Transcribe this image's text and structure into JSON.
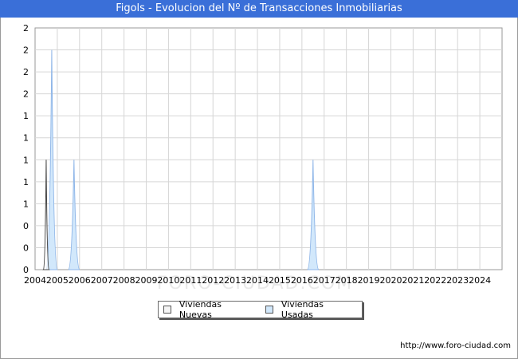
{
  "page": {
    "title": "Figols - Evolucion del Nº de Transacciones Inmobiliarias",
    "watermark": "FORO-CIUDAD.COM",
    "footer_url": "http://www.foro-ciudad.com"
  },
  "legend": {
    "items": [
      {
        "label": "Viviendas Nuevas",
        "color": "#f4f4f4"
      },
      {
        "label": "Viviendas Usadas",
        "color": "#d2e8fb"
      }
    ]
  },
  "colors": {
    "title_bar": "#3a6fd8",
    "grid": "#d6d6d6",
    "nuevas_stroke": "#444444",
    "usadas_fill": "#d2e8fb",
    "usadas_stroke": "#8fb6e8"
  },
  "chart_data": {
    "type": "area",
    "title": "Figols - Evolucion del Nº de Transacciones Inmobiliarias",
    "xlim": [
      2004,
      2025
    ],
    "ylim": [
      0,
      2.2
    ],
    "x_ticks": [
      "2004",
      "2005",
      "2006",
      "2007",
      "2008",
      "2009",
      "2010",
      "2011",
      "2012",
      "2013",
      "2014",
      "2015",
      "2016",
      "2017",
      "2018",
      "2019",
      "2020",
      "2021",
      "2022",
      "2023",
      "2024"
    ],
    "y_ticks": [
      "0",
      "0",
      "0",
      "1",
      "1",
      "1",
      "1",
      "1",
      "2",
      "2",
      "2",
      "2"
    ],
    "grid": true,
    "legend_position": "bottom-center",
    "series": [
      {
        "name": "Viviendas Nuevas",
        "points": [
          [
            2004.5,
            1
          ]
        ],
        "peak_width_years": 0.25
      },
      {
        "name": "Viviendas Usadas",
        "points": [
          [
            2004.75,
            2
          ],
          [
            2005.75,
            1
          ],
          [
            2016.5,
            1
          ]
        ],
        "peak_width_years": 0.5
      }
    ]
  }
}
